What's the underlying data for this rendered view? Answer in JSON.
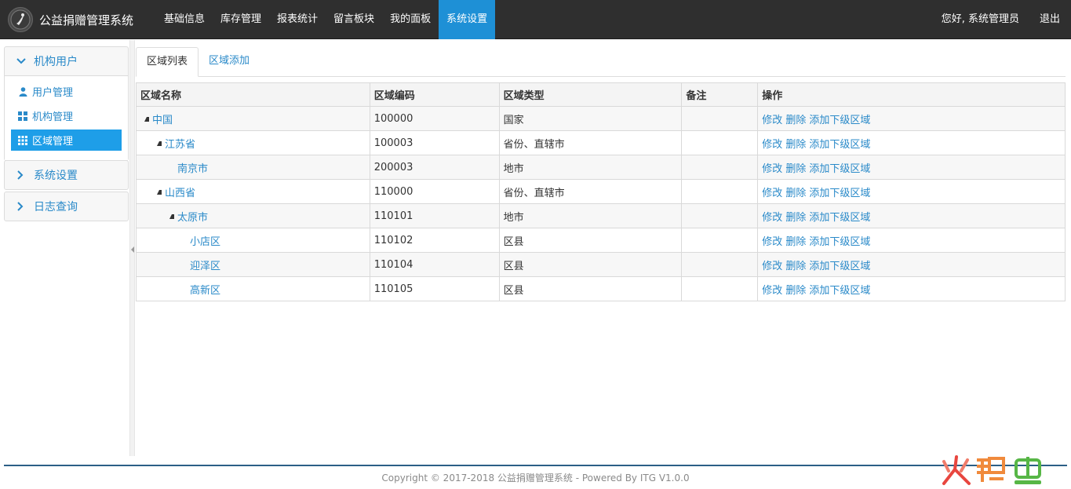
{
  "app": {
    "title": "公益捐赠管理系统",
    "greeting": "您好, 系统管理员",
    "logout": "退出"
  },
  "nav": {
    "items": [
      {
        "label": "基础信息"
      },
      {
        "label": "库存管理"
      },
      {
        "label": "报表统计"
      },
      {
        "label": "留言板块"
      },
      {
        "label": "我的面板"
      },
      {
        "label": "系统设置",
        "active": true
      }
    ]
  },
  "sidebar": {
    "groups": [
      {
        "label": "机构用户",
        "expanded": true,
        "icon": "chevron-down-icon",
        "items": [
          {
            "label": "用户管理",
            "icon": "user-icon"
          },
          {
            "label": "机构管理",
            "icon": "grid-icon"
          },
          {
            "label": "区域管理",
            "icon": "table-icon",
            "active": true
          }
        ]
      },
      {
        "label": "系统设置",
        "expanded": false,
        "icon": "chevron-right-icon"
      },
      {
        "label": "日志查询",
        "expanded": false,
        "icon": "chevron-right-icon"
      }
    ]
  },
  "tabs": [
    {
      "label": "区域列表",
      "active": true
    },
    {
      "label": "区域添加",
      "active": false
    }
  ],
  "table": {
    "columns": [
      "区域名称",
      "区域编码",
      "区域类型",
      "备注",
      "操作"
    ],
    "actions": [
      "修改",
      "删除",
      "添加下级区域"
    ],
    "rows": [
      {
        "name": "中国",
        "code": "100000",
        "type": "国家",
        "note": "",
        "level": 0,
        "expandable": true
      },
      {
        "name": "江苏省",
        "code": "100003",
        "type": "省份、直辖市",
        "note": "",
        "level": 1,
        "expandable": true
      },
      {
        "name": "南京市",
        "code": "200003",
        "type": "地市",
        "note": "",
        "level": 2,
        "expandable": false
      },
      {
        "name": "山西省",
        "code": "110000",
        "type": "省份、直辖市",
        "note": "",
        "level": 1,
        "expandable": true
      },
      {
        "name": "太原市",
        "code": "110101",
        "type": "地市",
        "note": "",
        "level": 2,
        "expandable": true
      },
      {
        "name": "小店区",
        "code": "110102",
        "type": "区县",
        "note": "",
        "level": 3,
        "expandable": false
      },
      {
        "name": "迎泽区",
        "code": "110104",
        "type": "区县",
        "note": "",
        "level": 3,
        "expandable": false
      },
      {
        "name": "高新区",
        "code": "110105",
        "type": "区县",
        "note": "",
        "level": 3,
        "expandable": false
      }
    ]
  },
  "footer": {
    "text": "Copyright © 2017-2018 公益捐赠管理系统 - Powered By ITG V1.0.0"
  },
  "colors": {
    "navbar": "#2f2f2f",
    "accent": "#1e90d6",
    "link": "#2a8ac9"
  }
}
